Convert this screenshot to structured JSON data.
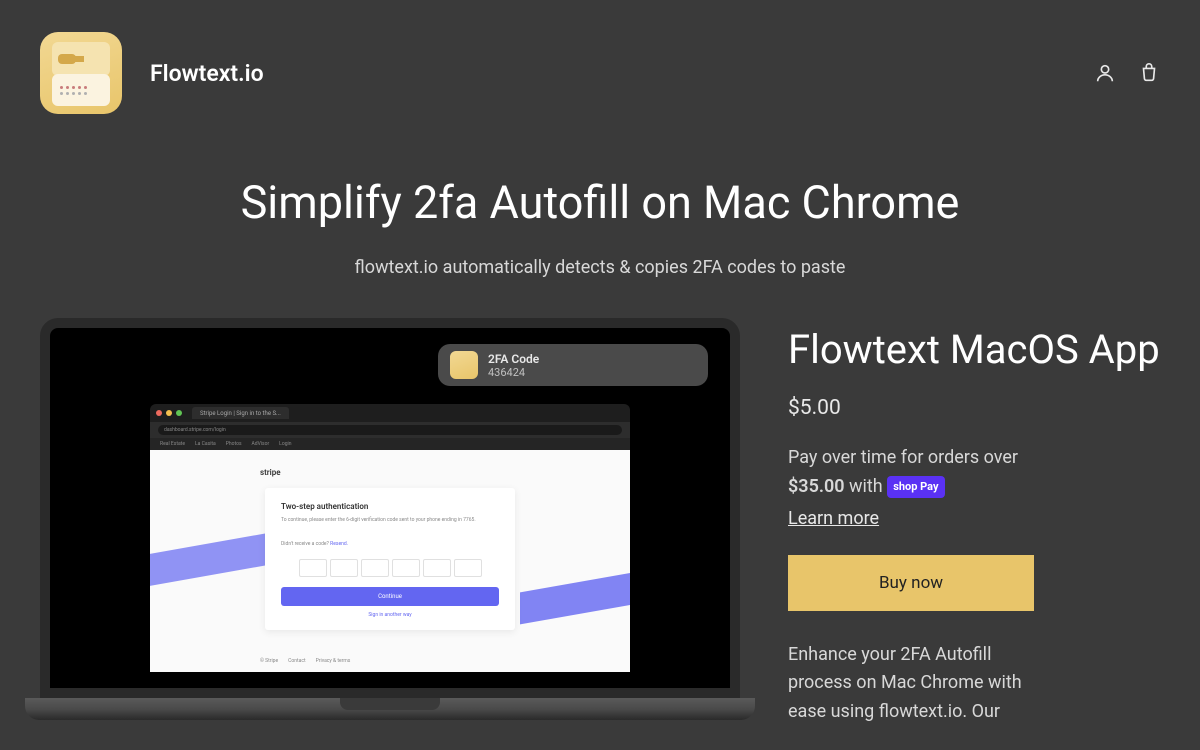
{
  "brand": "Flowtext.io",
  "hero": {
    "title": "Simplify 2fa Autofill on Mac Chrome",
    "subtitle": "flowtext.io automatically detects & copies 2FA codes to paste"
  },
  "notification": {
    "title": "2FA Code",
    "code": "436424"
  },
  "browser": {
    "tab_label": "Stripe Login | Sign in to the S...",
    "url": "dashboard.stripe.com/login",
    "bookmarks": [
      "Real Estate",
      "La Casita",
      "Photos",
      "AdVisor",
      "Login"
    ],
    "stripe_logo": "stripe",
    "auth": {
      "title": "Two-step authentication",
      "desc": "To continue, please enter the 6-digit verification code sent to your phone ending in 7765.",
      "resend_prefix": "Didn't receive a code? ",
      "resend_link": "Resend.",
      "continue": "Continue",
      "alt": "Sign in another way"
    },
    "footer": [
      "© Stripe",
      "Contact",
      "Privacy & terms"
    ]
  },
  "product": {
    "title": "Flowtext MacOS App",
    "price": "$5.00",
    "pay_over_prefix": "Pay over time for orders over",
    "pay_over_amount": "$35.00",
    "pay_over_with": "with",
    "shop_pay": "shop Pay",
    "learn_more": "Learn more",
    "buy_label": "Buy now",
    "description": "Enhance your 2FA Autofill process on Mac Chrome with ease using flowtext.io. Our"
  }
}
